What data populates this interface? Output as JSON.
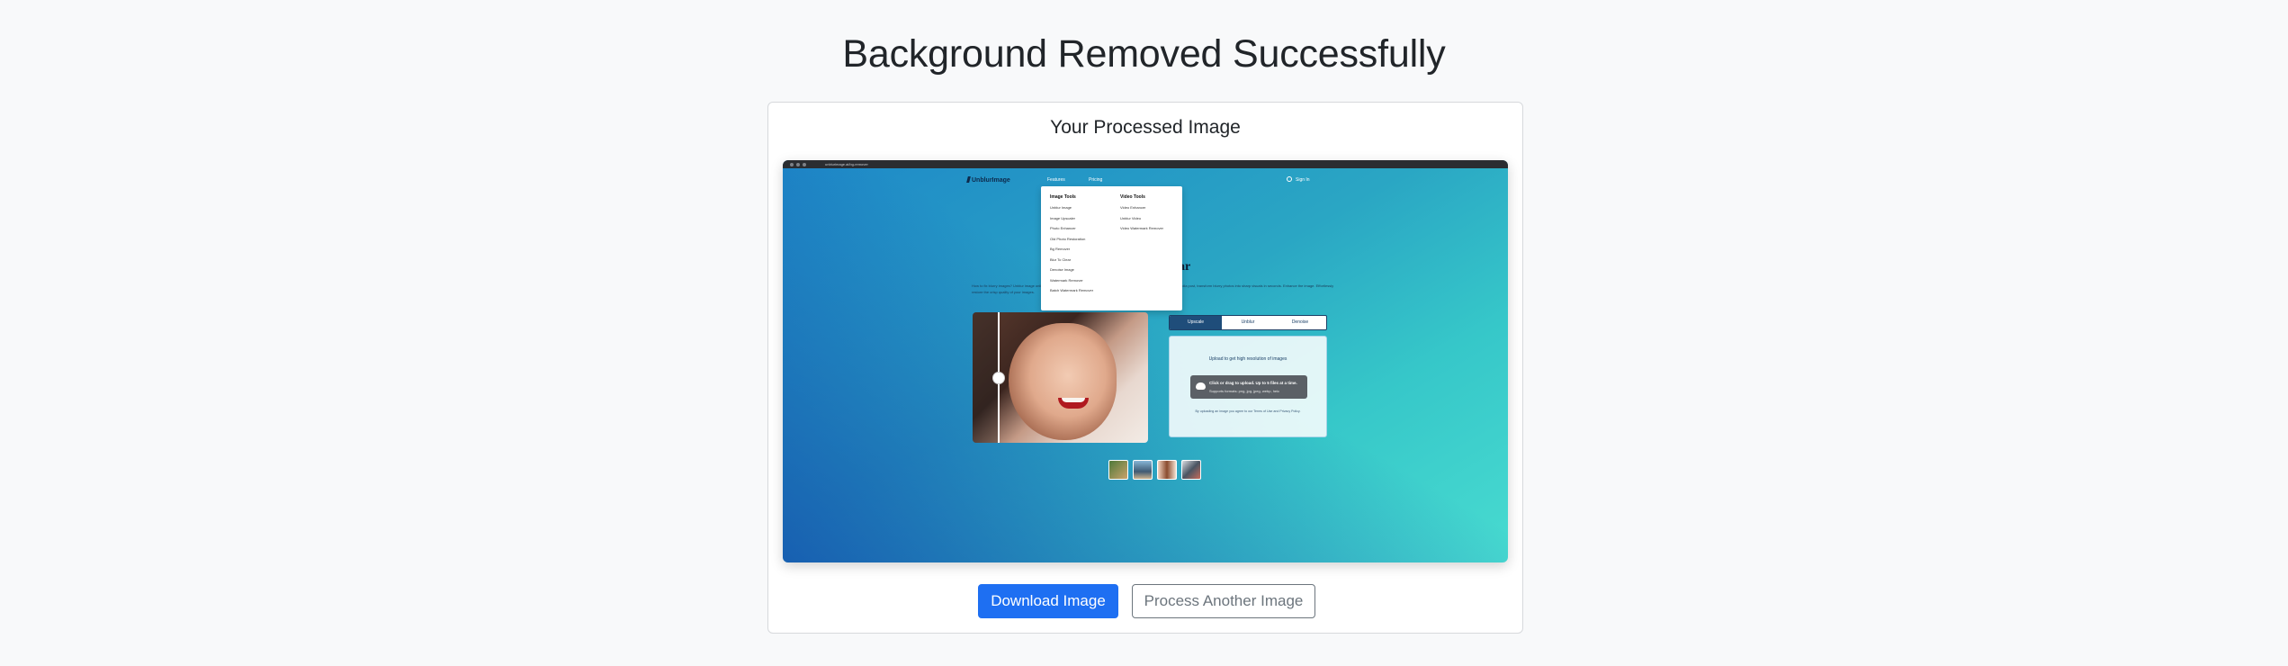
{
  "page": {
    "title": "Background Removed Successfully"
  },
  "card": {
    "title": "Your Processed Image"
  },
  "screenshot": {
    "browser_url": "unblurimage.ai/bg-remover",
    "logo_text": "UnblurImage",
    "nav": {
      "features": "Features",
      "pricing": "Pricing",
      "sign_in": "Sign In"
    },
    "dropdown": {
      "image_tools_heading": "Image Tools",
      "image_tools": [
        "Unblur Image",
        "Image Upscaler",
        "Photo Enhancer",
        "Old Photo Restoration",
        "Bg Remover",
        "Blur To Clear",
        "Denoise Image",
        "Watermark Remover",
        "Batch Watermark Remover"
      ],
      "video_tools_heading": "Video Tools",
      "video_tools": [
        "Video Enhancer",
        "Unblur Video",
        "Video Watermark Remover"
      ]
    },
    "hero_title": "ar",
    "hero_text": "How to fix blurry images? Unblur image online for free with AI. Restore clarity in a snap. Whether for a detailed project or a social media post, transform blurry photos into sharp visuals in seconds. Enhance the image. Effortlessly restore the crisp quality of your images.",
    "tabs": [
      "Upscale",
      "Unblur",
      "Denoise"
    ],
    "active_tab": "Upscale",
    "upload": {
      "heading": "Upload to get high resolution of images",
      "button_line1": "Click or drag to upload. Up to 5 files at a time.",
      "button_line2": "Supports formats: png, jpg, jpeg, webp, heic",
      "terms": "By uploading an image you agree to our Terms of Use and Privacy Policy."
    }
  },
  "actions": {
    "download_label": "Download Image",
    "process_another_label": "Process Another Image"
  },
  "colors": {
    "primary": "#1e6ff2",
    "secondary_outline": "#6c757d",
    "background": "#f8f9fa"
  }
}
